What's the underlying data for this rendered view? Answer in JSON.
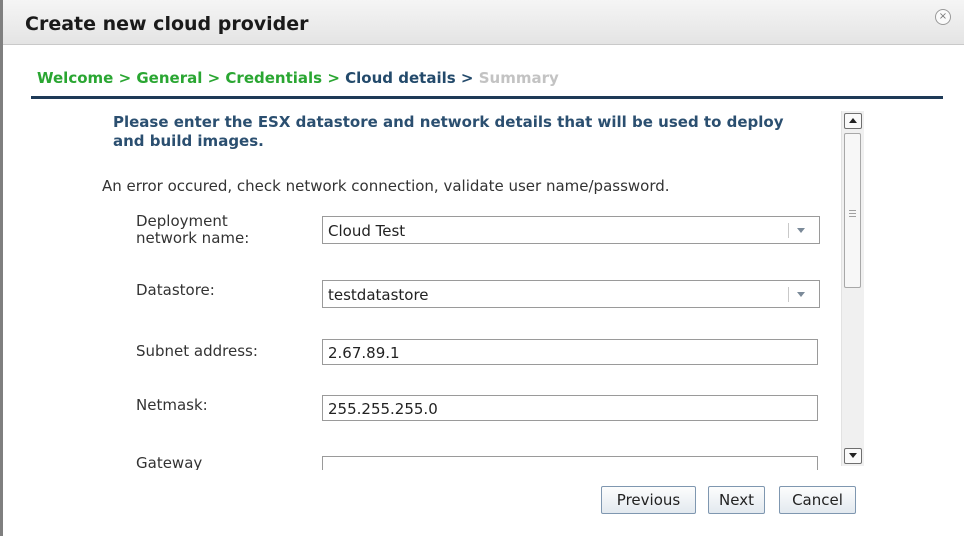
{
  "dialog": {
    "title": "Create new cloud provider",
    "close_icon": "close-circle-icon"
  },
  "breadcrumb": {
    "steps": [
      {
        "label": "Welcome",
        "state": "done"
      },
      {
        "label": "General",
        "state": "done"
      },
      {
        "label": "Credentials",
        "state": "done"
      },
      {
        "label": "Cloud details",
        "state": "current"
      },
      {
        "label": "Summary",
        "state": "future"
      }
    ],
    "separator": ">"
  },
  "instructions": "Please enter the ESX datastore and network details that will be used to deploy and build images.",
  "error_message": "An error occured, check network connection, validate user name/password.",
  "form": {
    "deployment_network": {
      "label": "Deployment network name:",
      "value": "Cloud Test"
    },
    "datastore": {
      "label": "Datastore:",
      "value": "testdatastore"
    },
    "subnet": {
      "label": "Subnet address:",
      "value": "2.67.89.1"
    },
    "netmask": {
      "label": "Netmask:",
      "value": "255.255.255.0"
    },
    "gateway": {
      "label": "Gateway",
      "value": ""
    }
  },
  "buttons": {
    "previous": "Previous",
    "next": "Next",
    "cancel": "Cancel"
  },
  "colors": {
    "completed_step": "#2aa632",
    "current_step": "#234a6b",
    "future_step": "#c3c3c3",
    "instruction_text": "#2b4f70"
  }
}
